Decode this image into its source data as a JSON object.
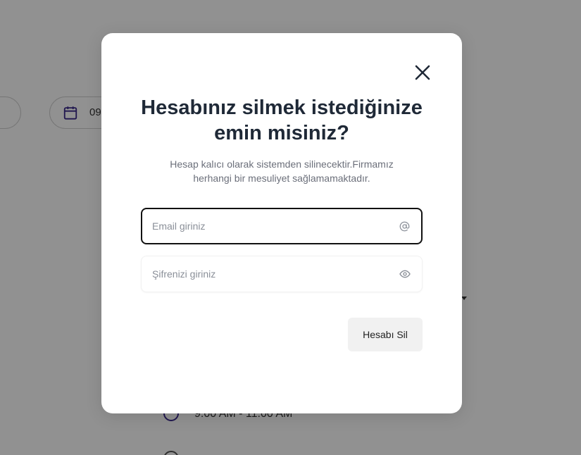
{
  "background": {
    "date_value": "09",
    "time_slot": "9:00 AM - 11:00 AM"
  },
  "modal": {
    "title": "Hesabınız silmek istediğinize emin misiniz?",
    "subtitle": "Hesap kalıcı olarak sistemden silinecektir.Firmamız herhangi bir mesuliyet sağlamamaktadır.",
    "email_field": {
      "value": "",
      "placeholder": "Email giriniz",
      "icon": "at-icon"
    },
    "password_field": {
      "value": "",
      "placeholder": "Şifrenizi giriniz",
      "icon": "eye-icon"
    },
    "delete_button_label": "Hesabı Sil",
    "close_icon": "close-icon"
  },
  "colors": {
    "overlay": "#6e6e6e",
    "title": "#1f2937",
    "accent_purple": "#3a2a8c",
    "button_bg": "#f1f1f1"
  }
}
